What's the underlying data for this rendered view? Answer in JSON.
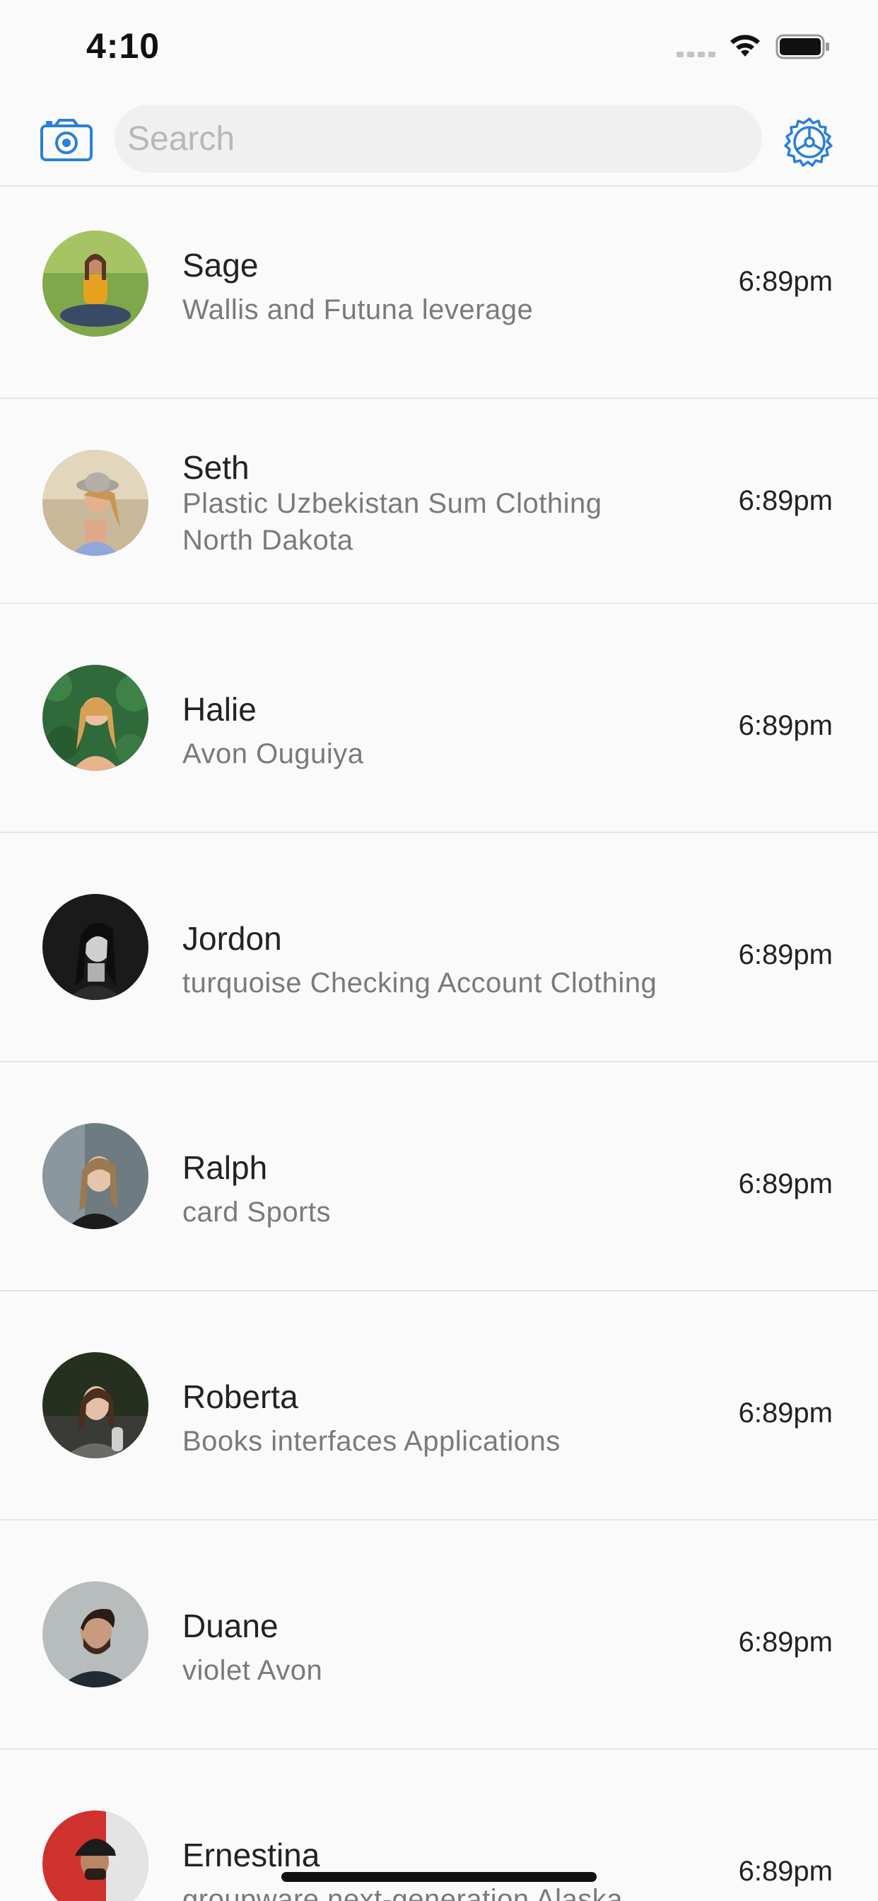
{
  "status_bar": {
    "time": "4:10"
  },
  "header": {
    "search_placeholder": "Search",
    "camera_icon": "camera-icon",
    "settings_icon": "gear-icon",
    "accent_color": "#2b7fd6"
  },
  "conversations": [
    {
      "name": "Sage",
      "preview": "Wallis and Futuna leverage",
      "time": "6:89pm"
    },
    {
      "name": "Seth",
      "preview": "Plastic Uzbekistan Sum Clothing North Dakota",
      "time": "6:89pm"
    },
    {
      "name": "Halie",
      "preview": "Avon Ouguiya",
      "time": "6:89pm"
    },
    {
      "name": "Jordon",
      "preview": "turquoise Checking Account Clothing",
      "time": "6:89pm"
    },
    {
      "name": "Ralph",
      "preview": "card Sports",
      "time": "6:89pm"
    },
    {
      "name": "Roberta",
      "preview": "Books interfaces Applications",
      "time": "6:89pm"
    },
    {
      "name": "Duane",
      "preview": "violet Avon",
      "time": "6:89pm"
    },
    {
      "name": "Ernestina",
      "preview": "groupware next-generation Alaska",
      "time": "6:89pm"
    }
  ]
}
